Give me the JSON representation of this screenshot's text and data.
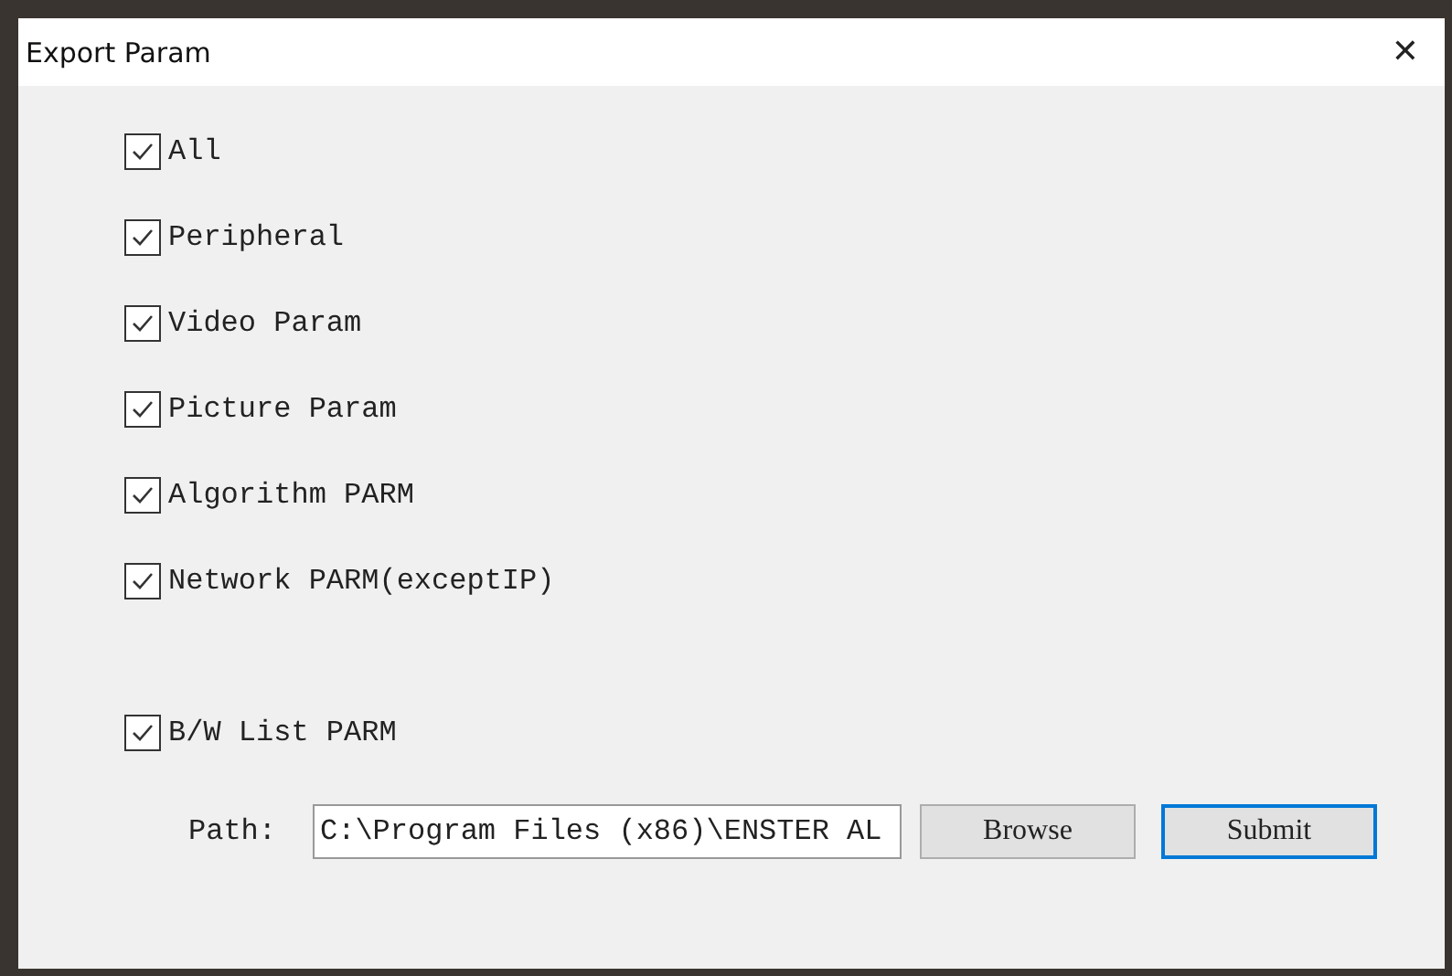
{
  "window": {
    "title": "Export Param",
    "close": "✕"
  },
  "options": [
    {
      "label": "All",
      "checked": true
    },
    {
      "label": "Peripheral",
      "checked": true
    },
    {
      "label": "Video Param",
      "checked": true
    },
    {
      "label": "Picture Param",
      "checked": true
    },
    {
      "label": "Algorithm PARM",
      "checked": true
    },
    {
      "label": "Network PARM(exceptIP)",
      "checked": true
    }
  ],
  "bw_option": {
    "label": "B/W List PARM",
    "checked": true
  },
  "path": {
    "label": "Path:",
    "value": "C:\\Program Files (x86)\\ENSTER AL"
  },
  "buttons": [
    {
      "label": "Browse",
      "focused": false
    },
    {
      "label": "Submit",
      "focused": true
    }
  ]
}
